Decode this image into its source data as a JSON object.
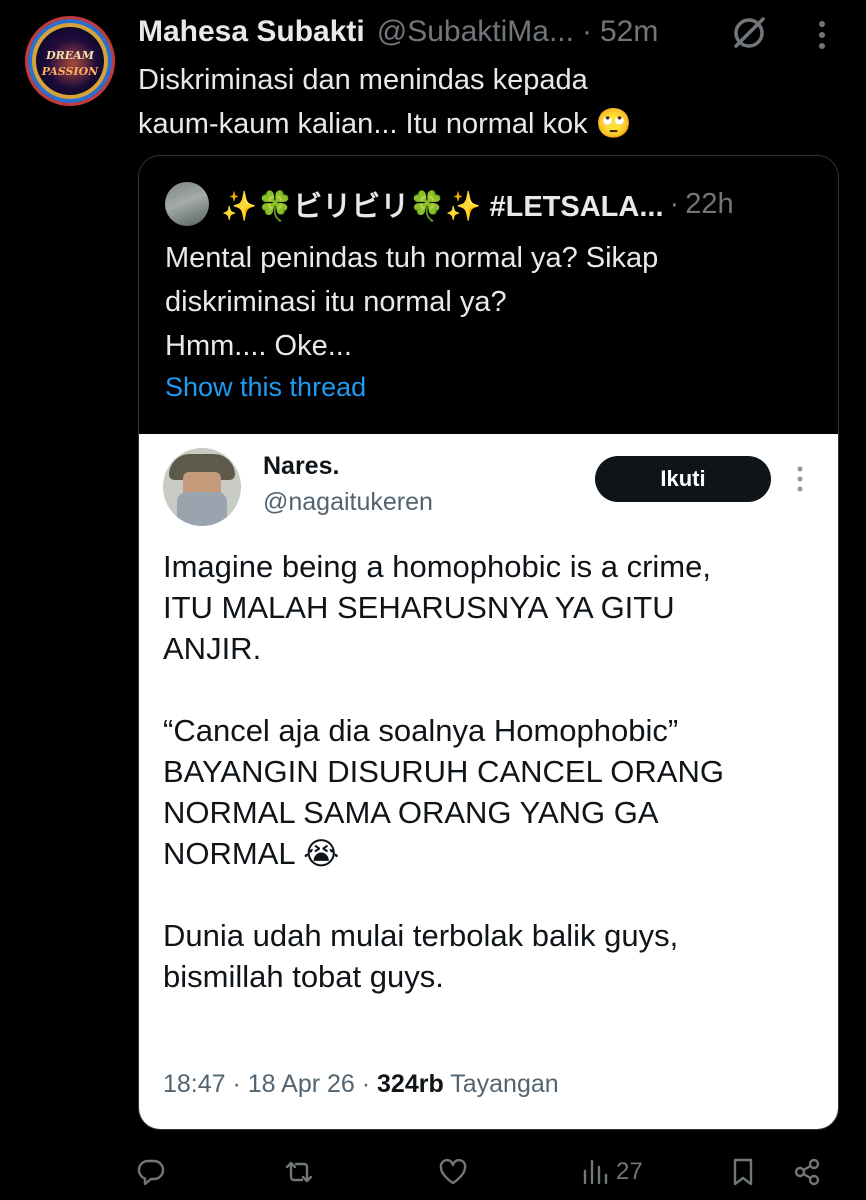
{
  "author": {
    "name": "Mahesa Subakti",
    "handle": "@SubaktiMa...",
    "separator": "·",
    "time": "52m",
    "avatar_text_top": "DREAM",
    "avatar_text_bottom": "PASSION"
  },
  "tweet": {
    "line1": "Diskriminasi dan menindas kepada",
    "line2": "kaum-kaum kalian... Itu normal kok 🙄"
  },
  "quote": {
    "name": "✨🍀ビリビリ🍀✨ #LETSALA...",
    "separator": "·",
    "time": "22h",
    "line1": "Mental penindas tuh normal ya? Sikap",
    "line2": "diskriminasi itu normal ya?",
    "line3": "Hmm.... Oke...",
    "show_thread": "Show this thread"
  },
  "embedded": {
    "name": "Nares.",
    "handle": "@nagaitukeren",
    "follow_label": "Ikuti",
    "para1_line1": "Imagine being a homophobic is a crime,",
    "para1_line2": "ITU MALAH SEHARUSNYA YA GITU",
    "para1_line3": "ANJIR.",
    "para2_line1": "“Cancel aja dia soalnya Homophobic”",
    "para2_line2": "BAYANGIN DISURUH CANCEL ORANG",
    "para2_line3": "NORMAL SAMA ORANG YANG GA",
    "para2_line4": "NORMAL 😭",
    "para3_line1": "Dunia udah mulai terbolak balik guys,",
    "para3_line2": "bismillah tobat guys.",
    "meta_time": "18:47 · 18 Apr 26 · ",
    "meta_views": "324rb",
    "meta_views_label": " Tayangan"
  },
  "actions": {
    "views_count": "27"
  },
  "icons": [
    "reply-icon",
    "retweet-icon",
    "like-icon",
    "views-icon",
    "bookmark-icon",
    "share-icon",
    "grok-icon",
    "more-icon"
  ],
  "colors": {
    "background": "#000000",
    "text": "#e7e9ea",
    "muted": "#71767b",
    "link": "#1d9bf0",
    "embed_bg": "#ffffff"
  }
}
